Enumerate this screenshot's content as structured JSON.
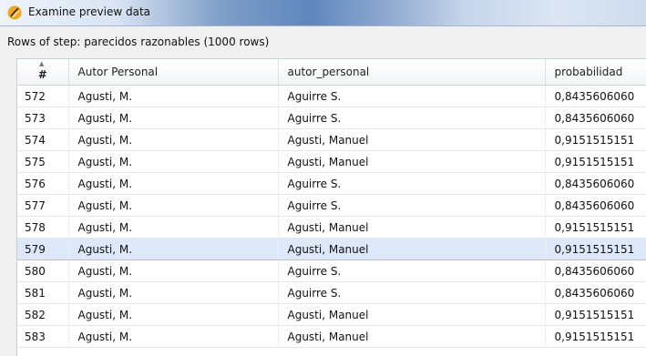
{
  "window": {
    "title": "Examine preview data"
  },
  "step_label": "Rows of step: parecidos razonables (1000 rows)",
  "table": {
    "columns": [
      "#",
      "Autor Personal",
      "autor_personal",
      "probabilidad"
    ],
    "selected_row": "579",
    "rows": [
      [
        "572",
        "Agusti, M.",
        "Aguirre S.",
        "0,8435606060"
      ],
      [
        "573",
        "Agusti, M.",
        "Aguirre S.",
        "0,8435606060"
      ],
      [
        "574",
        "Agusti, M.",
        "Agusti, Manuel",
        "0,9151515151"
      ],
      [
        "575",
        "Agusti, M.",
        "Agusti, Manuel",
        "0,9151515151"
      ],
      [
        "576",
        "Agusti, M.",
        "Aguirre S.",
        "0,8435606060"
      ],
      [
        "577",
        "Agusti, M.",
        "Aguirre S.",
        "0,8435606060"
      ],
      [
        "578",
        "Agusti, M.",
        "Agusti, Manuel",
        "0,9151515151"
      ],
      [
        "579",
        "Agusti, M.",
        "Agusti, Manuel",
        "0,9151515151"
      ],
      [
        "580",
        "Agusti, M.",
        "Aguirre S.",
        "0,8435606060"
      ],
      [
        "581",
        "Agusti, M.",
        "Aguirre S.",
        "0,8435606060"
      ],
      [
        "582",
        "Agusti, M.",
        "Agusti, Manuel",
        "0,9151515151"
      ],
      [
        "583",
        "Agusti, M.",
        "Agusti, Manuel",
        "0,9151515151"
      ]
    ]
  }
}
